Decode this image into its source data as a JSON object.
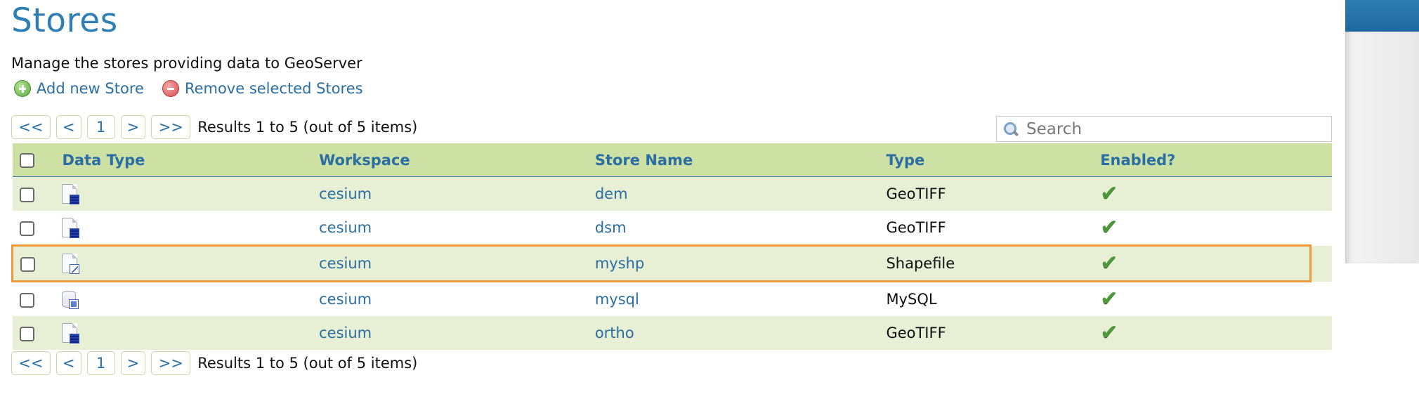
{
  "page": {
    "title": "Stores",
    "description": "Manage the stores providing data to GeoServer"
  },
  "actions": {
    "add_label": "Add new Store",
    "remove_label": "Remove selected Stores"
  },
  "pager": {
    "first": "<<",
    "prev": "<",
    "current": "1",
    "next": ">",
    "last": ">>",
    "results_text": "Results 1 to 5 (out of 5 items)"
  },
  "search": {
    "placeholder": "Search",
    "value": ""
  },
  "table": {
    "headers": {
      "data_type": "Data Type",
      "workspace": "Workspace",
      "store_name": "Store Name",
      "type": "Type",
      "enabled": "Enabled?"
    },
    "rows": [
      {
        "data_type_icon": "raster-file-icon",
        "workspace": "cesium",
        "store_name": "dem",
        "type": "GeoTIFF",
        "enabled": true
      },
      {
        "data_type_icon": "raster-file-icon",
        "workspace": "cesium",
        "store_name": "dsm",
        "type": "GeoTIFF",
        "enabled": true
      },
      {
        "data_type_icon": "vector-file-icon",
        "workspace": "cesium",
        "store_name": "myshp",
        "type": "Shapefile",
        "enabled": true,
        "highlighted": true
      },
      {
        "data_type_icon": "database-icon",
        "workspace": "cesium",
        "store_name": "mysql",
        "type": "MySQL",
        "enabled": true
      },
      {
        "data_type_icon": "raster-file-icon",
        "workspace": "cesium",
        "store_name": "ortho",
        "type": "GeoTIFF",
        "enabled": true
      }
    ]
  },
  "colors": {
    "title": "#2f7fb5",
    "link": "#2a6ea3",
    "header_bg": "#cee1a4",
    "odd_row_bg": "#e7f0d5",
    "highlight_border": "#ef9a3a",
    "check_green": "#4e9a3a"
  }
}
